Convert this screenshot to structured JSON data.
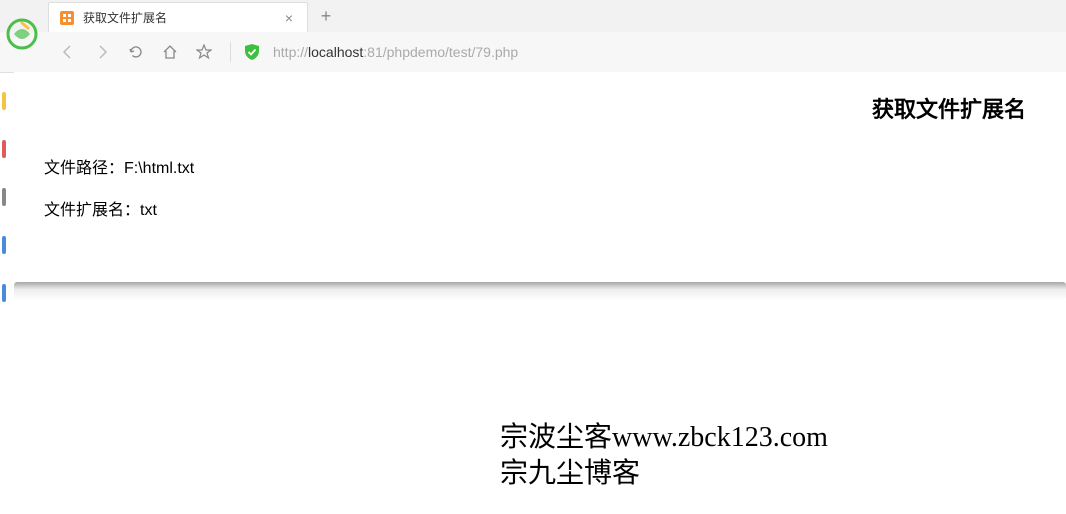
{
  "browser": {
    "tab_title": "获取文件扩展名",
    "url_prefix": "http://",
    "url_host": "localhost",
    "url_path": ":81/phpdemo/test/79.php"
  },
  "page": {
    "heading": "获取文件扩展名",
    "path_label": "文件路径：",
    "path_value": "F:\\html.txt",
    "ext_label": "文件扩展名：",
    "ext_value": "txt"
  },
  "watermark": {
    "line1": "宗波尘客www.zbck123.com",
    "line2": "宗九尘博客"
  }
}
